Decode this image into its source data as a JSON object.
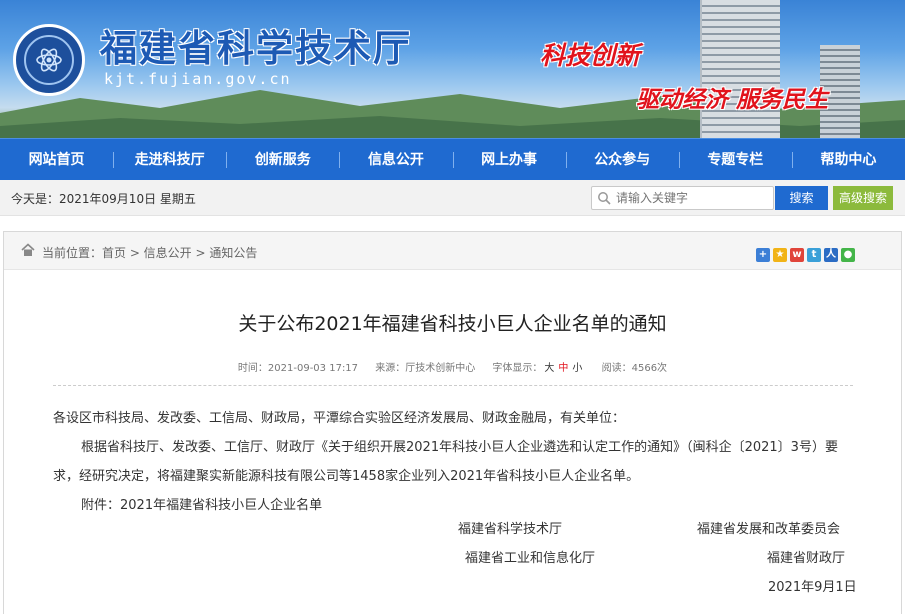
{
  "header": {
    "site_title": "福建省科学技术厅",
    "domain": "kjt.fujian.gov.cn",
    "slogan_line1": "科技创新",
    "slogan_line2": "驱动经济 服务民生"
  },
  "nav": {
    "items": [
      "网站首页",
      "走进科技厅",
      "创新服务",
      "信息公开",
      "网上办事",
      "公众参与",
      "专题专栏",
      "帮助中心"
    ]
  },
  "toolbar": {
    "date_text": "今天是：2021年09月10日  星期五",
    "search_placeholder": "请输入关键字",
    "search_label": "搜索",
    "advanced_label": "高级搜索"
  },
  "breadcrumb": {
    "text": "当前位置：首页 > 信息公开 > 通知公告"
  },
  "share_icons": [
    "plus-share-icon",
    "qzone-share-icon",
    "weibo-share-icon",
    "tencent-weibo-share-icon",
    "renren-share-icon",
    "wechat-share-icon"
  ],
  "article": {
    "title": "关于公布2021年福建省科技小巨人企业名单的通知",
    "meta": {
      "time": "时间：2021-09-03 17:17",
      "source": "来源：厅技术创新中心",
      "font_label": "字体显示：",
      "font_large": "大",
      "font_medium": "中",
      "font_small": "小",
      "views": "阅读：4566次"
    },
    "salutation": "各设区市科技局、发改委、工信局、财政局，平潭综合实验区经济发展局、财政金融局，有关单位：",
    "paragraph1": "根据省科技厅、发改委、工信厅、财政厅《关于组织开展2021年科技小巨人企业遴选和认定工作的通知》（闽科企〔2021〕3号）要求，经研究决定，将福建聚实新能源科技有限公司等1458家企业列入2021年省科技小巨人企业名单。",
    "attachment": "附件：2021年福建省科技小巨人企业名单",
    "signatures": {
      "sig1": "福建省科学技术厅",
      "sig2": "福建省发展和改革委员会",
      "sig3": "福建省工业和信息化厅",
      "sig4": "福建省财政厅",
      "date": "2021年9月1日"
    }
  },
  "colors": {
    "nav_blue": "#1f6ad0",
    "advanced_green": "#8cba3c",
    "accent_red": "#e1131c"
  }
}
